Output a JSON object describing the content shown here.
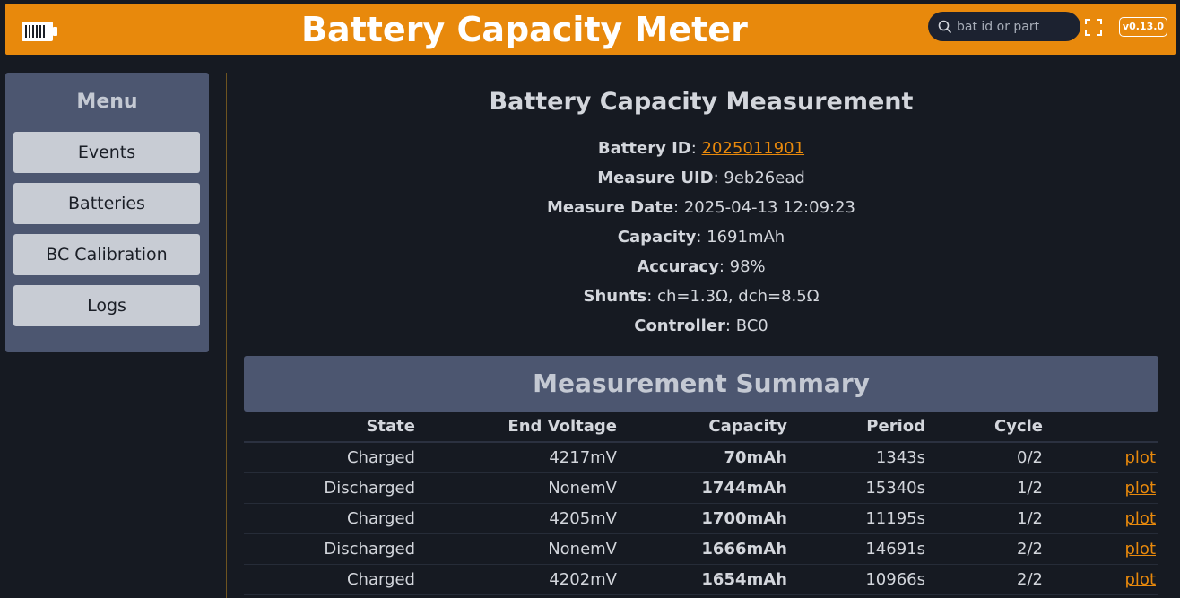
{
  "header": {
    "title": "Battery Capacity Meter",
    "search_placeholder": "bat id or part",
    "version": "v0.13.0",
    "icons": [
      "battery-icon",
      "search-icon",
      "fullscreen-icon"
    ],
    "color": "#e8890c"
  },
  "sidebar": {
    "title": "Menu",
    "items": [
      {
        "label": "Events"
      },
      {
        "label": "Batteries"
      },
      {
        "label": "BC Calibration"
      },
      {
        "label": "Logs"
      }
    ]
  },
  "details": {
    "title": "Battery Capacity Measurement",
    "battery_id_label": "Battery ID",
    "battery_id": "2025011901",
    "measure_uid_label": "Measure UID",
    "measure_uid": "9eb26ead",
    "measure_date_label": "Measure Date",
    "measure_date": "2025-04-13 12:09:23",
    "capacity_label": "Capacity",
    "capacity": "1691mAh",
    "accuracy_label": "Accuracy",
    "accuracy": "98%",
    "shunts_label": "Shunts",
    "shunts": "ch=1.3Ω, dch=8.5Ω",
    "controller_label": "Controller",
    "controller": "BC0"
  },
  "summary": {
    "title": "Measurement Summary",
    "columns": [
      "State",
      "End Voltage",
      "Capacity",
      "Period",
      "Cycle"
    ],
    "rows": [
      {
        "state": "Charged",
        "voltage": "4217mV",
        "capacity": "70mAh",
        "period": "1343s",
        "cycle": "0/2",
        "link": "plot"
      },
      {
        "state": "Discharged",
        "voltage": "NonemV",
        "capacity": "1744mAh",
        "period": "15340s",
        "cycle": "1/2",
        "link": "plot"
      },
      {
        "state": "Charged",
        "voltage": "4205mV",
        "capacity": "1700mAh",
        "period": "11195s",
        "cycle": "1/2",
        "link": "plot"
      },
      {
        "state": "Discharged",
        "voltage": "NonemV",
        "capacity": "1666mAh",
        "period": "14691s",
        "cycle": "2/2",
        "link": "plot"
      },
      {
        "state": "Charged",
        "voltage": "4202mV",
        "capacity": "1654mAh",
        "period": "10966s",
        "cycle": "2/2",
        "link": "plot"
      }
    ]
  }
}
